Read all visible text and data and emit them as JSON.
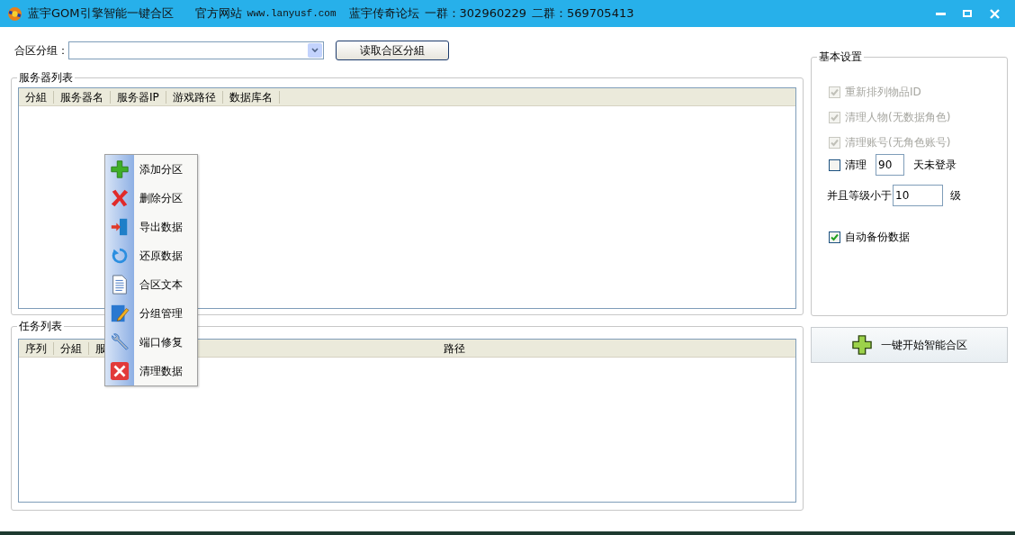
{
  "window": {
    "title": "蓝宇GOM引擎智能一键合区",
    "website_label": "官方网站",
    "website": "www.lanyusf.com",
    "forum": "蓝宇传奇论坛",
    "group_1": "一群：302960229",
    "group_2": "二群：569705413"
  },
  "merge_group": {
    "label": "合区分组："
  },
  "read_button": "读取合区分組",
  "server_list": {
    "title": "服务器列表",
    "columns": [
      "分組",
      "服务器名",
      "服务器IP",
      "游戏路径",
      "数据库名"
    ]
  },
  "task_list": {
    "title": "任务列表",
    "columns": [
      "序列",
      "分組",
      "服",
      "路径"
    ]
  },
  "context_menu": {
    "items": [
      {
        "label": "添加分区"
      },
      {
        "label": "删除分区"
      },
      {
        "label": "导出数据"
      },
      {
        "label": "还原数据"
      },
      {
        "label": "合区文本"
      },
      {
        "label": "分组管理"
      },
      {
        "label": "端口修复"
      },
      {
        "label": "清理数据"
      }
    ]
  },
  "settings": {
    "title": "基本设置",
    "options": [
      {
        "kind": "checkbox",
        "label": "重新排列物品ID",
        "checked": true,
        "disabled": true
      },
      {
        "kind": "checkbox",
        "label": "清理人物(无数据角色)",
        "checked": true,
        "disabled": true
      },
      {
        "kind": "checkbox",
        "label": "清理账号(无角色账号)",
        "checked": true,
        "disabled": true
      },
      {
        "kind": "checkbox-field",
        "label": "清理",
        "value": "90",
        "suffix": "天未登录",
        "checked": false,
        "disabled": false
      },
      {
        "kind": "field",
        "label": "并且等级小于",
        "value": "10",
        "suffix": "级"
      },
      {
        "kind": "checkbox",
        "label": "自动备份数据",
        "checked": true,
        "disabled": false
      }
    ]
  },
  "start_button": "一键开始智能合区"
}
